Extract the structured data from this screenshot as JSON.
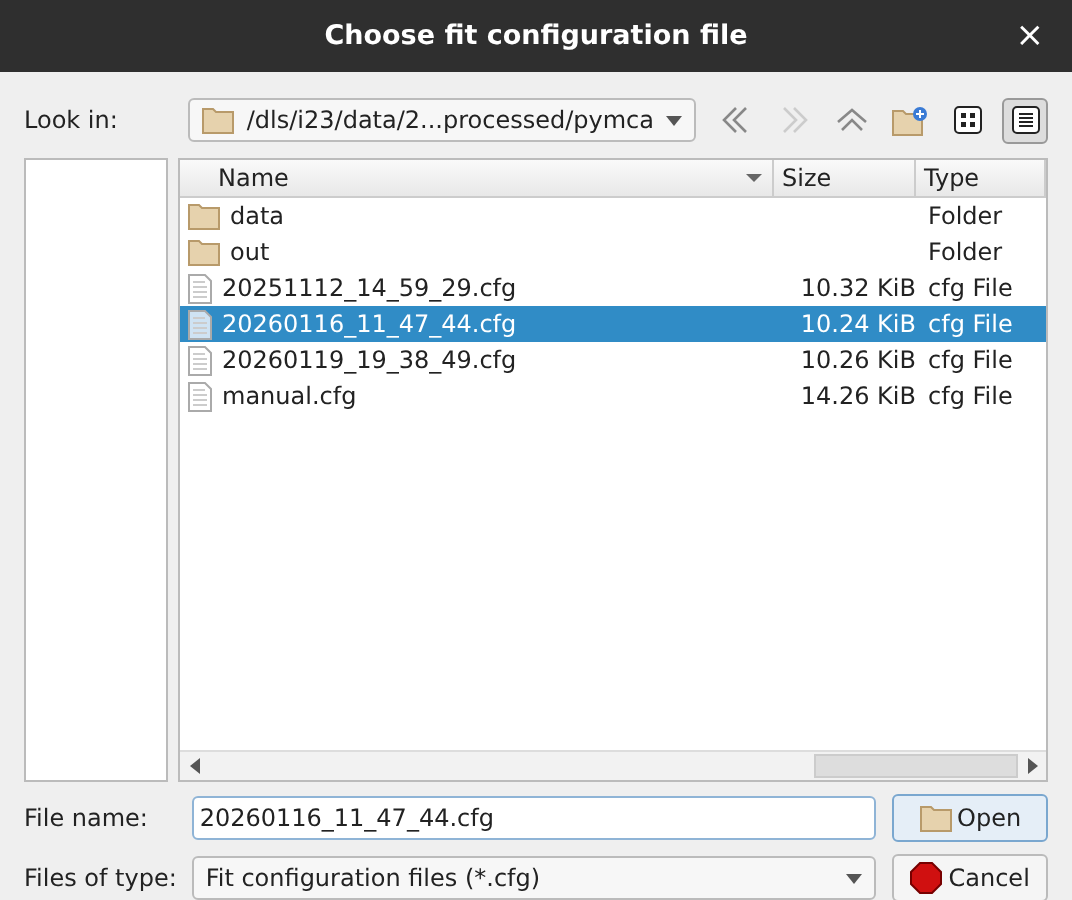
{
  "window": {
    "title": "Choose fit configuration file",
    "close": "×"
  },
  "look_in": {
    "label": "Look in:",
    "path": "/dls/i23/data/2...processed/pymca"
  },
  "toolbar": [
    {
      "kind": "back",
      "disabled": false
    },
    {
      "kind": "forward",
      "disabled": true
    },
    {
      "kind": "up",
      "disabled": false
    },
    {
      "kind": "new-folder",
      "disabled": false
    },
    {
      "kind": "icon-view",
      "selected": false
    },
    {
      "kind": "detail-view",
      "selected": true
    }
  ],
  "table": {
    "columns": [
      "Name",
      "Size",
      "Type"
    ],
    "rows": [
      {
        "kind": "folder",
        "name": "data",
        "size": "",
        "type": "Folder",
        "selected": false
      },
      {
        "kind": "folder",
        "name": "out",
        "size": "",
        "type": "Folder",
        "selected": false
      },
      {
        "kind": "file",
        "name": "20251112_14_59_29.cfg",
        "size": "10.32 KiB",
        "type": "cfg File",
        "selected": false
      },
      {
        "kind": "file",
        "name": "20260116_11_47_44.cfg",
        "size": "10.24 KiB",
        "type": "cfg File",
        "selected": true
      },
      {
        "kind": "file",
        "name": "20260119_19_38_49.cfg",
        "size": "10.26 KiB",
        "type": "cfg File",
        "selected": false
      },
      {
        "kind": "file",
        "name": "manual.cfg",
        "size": "14.26 KiB",
        "type": "cfg File",
        "selected": false
      }
    ]
  },
  "file_name": {
    "label": "File name:",
    "value": "20260116_11_47_44.cfg"
  },
  "file_type": {
    "label": "Files of type:",
    "value": "Fit configuration files (*.cfg)"
  },
  "buttons": [
    {
      "kind": "open",
      "label": "Open"
    },
    {
      "kind": "cancel",
      "label": "Cancel"
    }
  ]
}
